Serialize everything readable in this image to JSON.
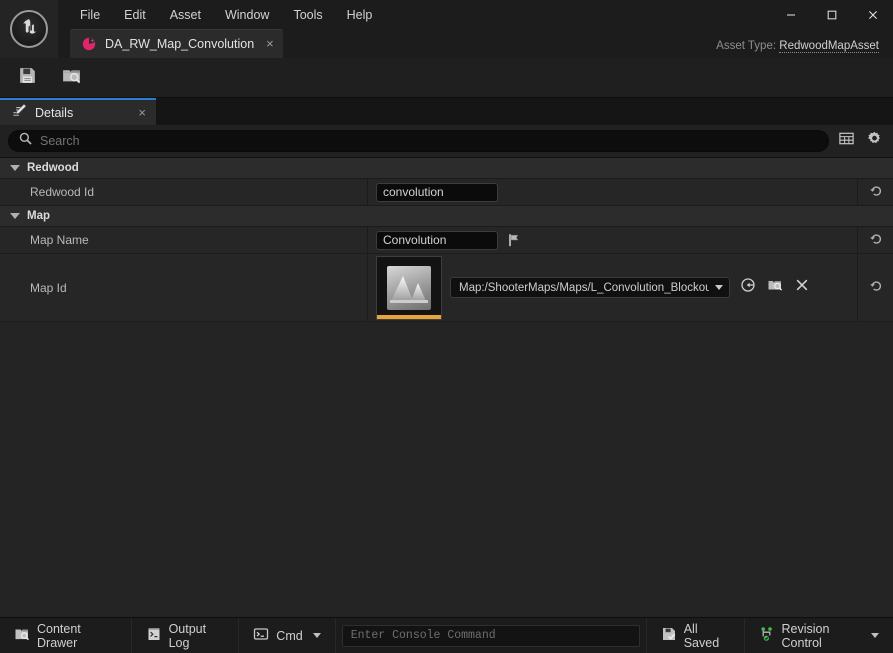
{
  "window": {
    "menu": [
      "File",
      "Edit",
      "Asset",
      "Window",
      "Tools",
      "Help"
    ],
    "controls": {
      "minimize": "minimize-icon",
      "maximize": "maximize-icon",
      "close": "close-icon"
    },
    "logo_icon": "unreal-engine-logo"
  },
  "tab": {
    "icon": "data-asset-icon",
    "label": "DA_RW_Map_Convolution",
    "close": "×"
  },
  "asset_type": {
    "label": "Asset Type:",
    "value": "RedwoodMapAsset"
  },
  "toolbar": {
    "buttons": [
      {
        "name": "save-button",
        "icon": "save-icon"
      },
      {
        "name": "browse-button",
        "icon": "browse-folder-icon"
      }
    ]
  },
  "details_panel": {
    "tab_icon": "details-pencil-icon",
    "tab_label": "Details",
    "tab_close": "×",
    "search": {
      "placeholder": "Search",
      "value": "",
      "icon": "search-icon"
    },
    "header_buttons": [
      {
        "name": "column-settings-button",
        "icon": "table-grid-icon"
      },
      {
        "name": "view-options-button",
        "icon": "gear-icon"
      }
    ]
  },
  "properties": [
    {
      "type": "category",
      "name": "category-redwood",
      "label": "Redwood",
      "expanded": true
    },
    {
      "type": "text",
      "name": "redwood-id",
      "label": "Redwood Id",
      "value": "convolution",
      "reset_icon": "reset-arrow-icon"
    },
    {
      "type": "category",
      "name": "category-map",
      "label": "Map",
      "expanded": true
    },
    {
      "type": "text-loc",
      "name": "map-name",
      "label": "Map Name",
      "value": "Convolution",
      "flag_icon": "localization-flag-icon",
      "reset_icon": "reset-arrow-icon"
    },
    {
      "type": "asset",
      "name": "map-id",
      "label": "Map Id",
      "thumbnail_icon": "map-thumbnail-icon",
      "asset_path": "Map:/ShooterMaps/Maps/L_Convolution_Blockout",
      "actions": [
        {
          "name": "browse-to-asset-button",
          "icon": "browse-to-asset-icon"
        },
        {
          "name": "use-selected-asset-button",
          "icon": "use-selected-asset-icon"
        },
        {
          "name": "clear-asset-button",
          "icon": "clear-x-icon"
        }
      ],
      "reset_icon": "reset-arrow-icon"
    }
  ],
  "status_bar": {
    "content_drawer": {
      "label": "Content Drawer",
      "icon": "content-drawer-icon"
    },
    "output_log": {
      "label": "Output Log",
      "icon": "output-log-icon"
    },
    "cmd": {
      "label": "Cmd",
      "icon": "cmd-prompt-icon"
    },
    "console": {
      "placeholder": "Enter Console Command",
      "value": ""
    },
    "all_saved": {
      "label": "All Saved",
      "icon": "save-check-icon"
    },
    "revision_control": {
      "label": "Revision Control",
      "icon": "revision-control-icon"
    }
  },
  "colors": {
    "accent_blue": "#2b7cd3",
    "accent_orange": "#e8a33d",
    "tab_pink": "#e0256b",
    "green": "#3fbf4f",
    "panel_bg": "#242424",
    "window_bg": "#1c1c1c"
  }
}
